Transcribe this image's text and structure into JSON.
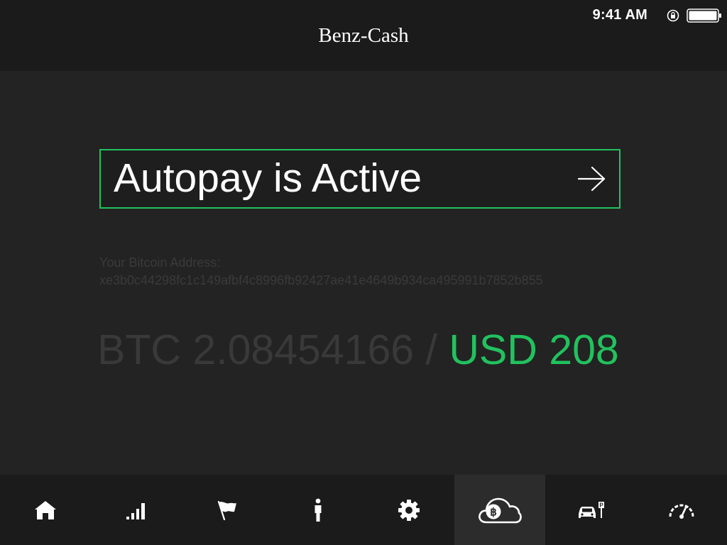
{
  "status_bar": {
    "time": "9:41 AM"
  },
  "header": {
    "title": "Benz-Cash"
  },
  "autopay": {
    "label": "Autopay is Active"
  },
  "wallet": {
    "address_label": "Your Bitcoin Address:",
    "address": "xe3b0c44298fc1c149afbf4c8996fb92427ae41e4649b934ca495991b7852b855"
  },
  "balance": {
    "btc": "BTC 2.08454166",
    "separator": "/",
    "usd": "USD 208"
  },
  "nav": {
    "items": [
      {
        "icon": "home-icon",
        "active": false
      },
      {
        "icon": "signal-icon",
        "active": false
      },
      {
        "icon": "flag-icon",
        "active": false
      },
      {
        "icon": "person-icon",
        "active": false
      },
      {
        "icon": "gear-icon",
        "active": false
      },
      {
        "icon": "bitcoin-cloud-icon",
        "active": true
      },
      {
        "icon": "car-parking-icon",
        "active": false
      },
      {
        "icon": "speedometer-icon",
        "active": false
      }
    ]
  },
  "colors": {
    "accent": "#21c25e",
    "background": "#232323",
    "bar_background": "#1b1b1b",
    "muted_text": "#3a3a3a"
  }
}
